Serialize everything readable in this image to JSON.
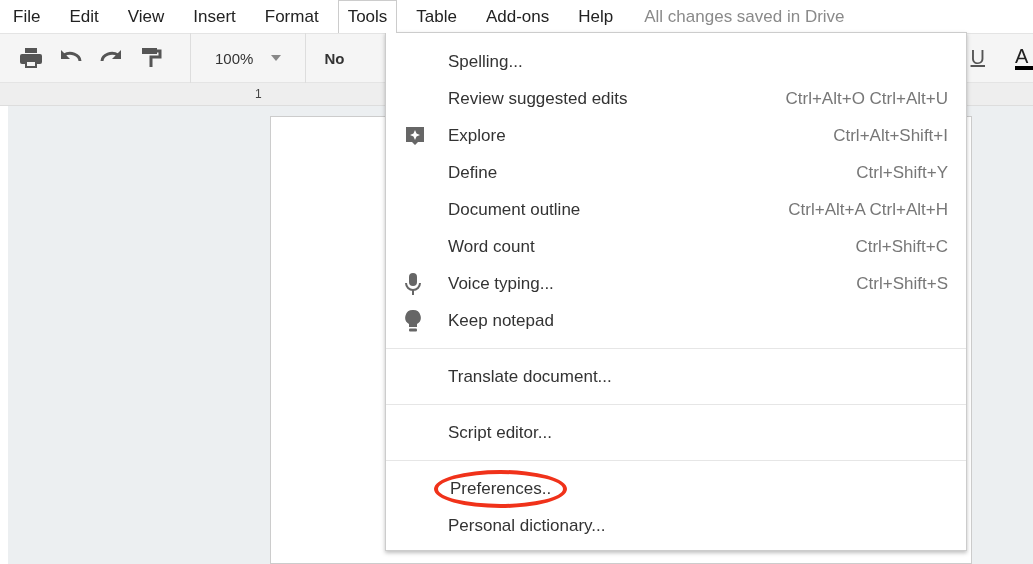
{
  "menubar": {
    "items": [
      {
        "label": "File",
        "selected": false
      },
      {
        "label": "Edit",
        "selected": false
      },
      {
        "label": "View",
        "selected": false
      },
      {
        "label": "Insert",
        "selected": false
      },
      {
        "label": "Format",
        "selected": false
      },
      {
        "label": "Tools",
        "selected": true
      },
      {
        "label": "Table",
        "selected": false
      },
      {
        "label": "Add-ons",
        "selected": false
      },
      {
        "label": "Help",
        "selected": false
      }
    ],
    "status": "All changes saved in Drive"
  },
  "toolbar": {
    "zoom": "100%",
    "style": "No",
    "underline": "U",
    "text_color": "A"
  },
  "ruler": {
    "label": "1"
  },
  "menu": {
    "groups": [
      [
        {
          "label": "Spelling...",
          "circled": false
        },
        {
          "label": "Review suggested edits",
          "shortcut": "Ctrl+Alt+O Ctrl+Alt+U",
          "circled": false
        },
        {
          "label": "Explore",
          "shortcut": "Ctrl+Alt+Shift+I",
          "kind": "explore",
          "circled": false
        },
        {
          "label": "Define",
          "shortcut": "Ctrl+Shift+Y",
          "circled": false
        },
        {
          "label": "Document outline",
          "shortcut": "Ctrl+Alt+A Ctrl+Alt+H",
          "circled": false
        },
        {
          "label": "Word count",
          "shortcut": "Ctrl+Shift+C",
          "circled": false
        },
        {
          "label": "Voice typing...",
          "shortcut": "Ctrl+Shift+S",
          "kind": "mic",
          "circled": false
        },
        {
          "label": "Keep notepad",
          "kind": "bulb",
          "circled": false
        }
      ],
      [
        {
          "label": "Translate document...",
          "circled": false
        }
      ],
      [
        {
          "label": "Script editor...",
          "circled": false
        }
      ],
      [
        {
          "label": "Preferences..",
          "circled": true
        },
        {
          "label": "Personal dictionary...",
          "circled": false
        }
      ]
    ]
  }
}
